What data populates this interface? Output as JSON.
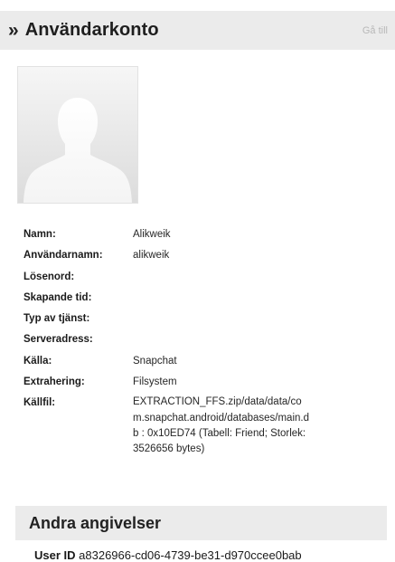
{
  "header": {
    "title": "Användarkonto",
    "goto_label": "Gå till",
    "chevron": "»"
  },
  "details": [
    {
      "label": "Namn:",
      "value": "Alikweik"
    },
    {
      "label": "Användarnamn:",
      "value": "alikweik"
    },
    {
      "label": "Lösenord:",
      "value": ""
    },
    {
      "label": "Skapande tid:",
      "value": ""
    },
    {
      "label": "Typ av tjänst:",
      "value": ""
    },
    {
      "label": "Serveradress:",
      "value": ""
    },
    {
      "label": "Källa:",
      "value": "Snapchat"
    },
    {
      "label": "Extrahering:",
      "value": "Filsystem"
    },
    {
      "label": "Källfil:",
      "value": "EXTRACTION_FFS.zip/data/data/com.snapchat.android/databases/main.db : 0x10ED74 (Tabell: Friend; Storlek: 3526656 bytes)"
    }
  ],
  "other": {
    "title": "Andra angivelser",
    "user_id_label": "User ID",
    "user_id_value": "a8326966-cd06-4739-be31-d970ccee0bab"
  }
}
